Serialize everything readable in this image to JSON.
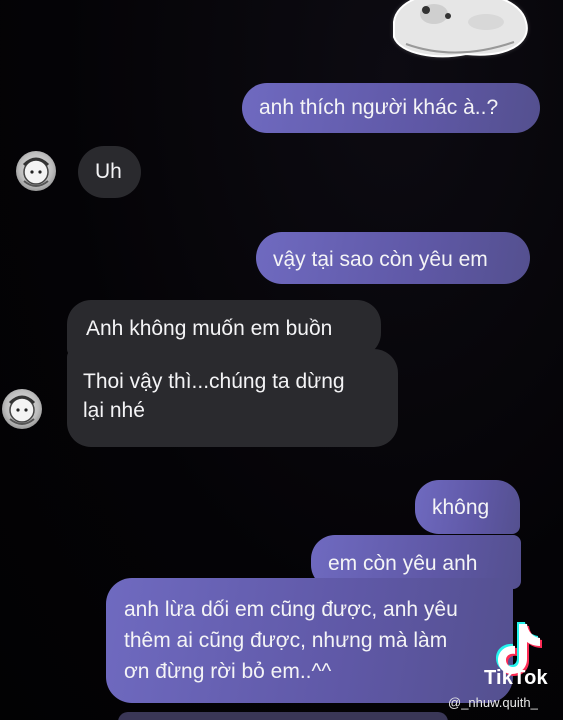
{
  "messages": [
    {
      "side": "sent",
      "text": "anh thích người khác à..?"
    },
    {
      "side": "received",
      "text": "Uh"
    },
    {
      "side": "sent",
      "text": "vậy tại sao còn yêu em"
    },
    {
      "side": "received",
      "text": "Anh không muốn em buồn"
    },
    {
      "side": "received",
      "text": "Thoi vậy thì...chúng ta dừng\nlại nhé"
    },
    {
      "side": "sent",
      "text": "không"
    },
    {
      "side": "sent",
      "text": "em còn yêu anh"
    },
    {
      "side": "sent",
      "text": "anh lừa dối em cũng được, anh yêu\nthêm ai cũng được, nhưng mà làm\nơn đừng rời bỏ em..^^"
    }
  ],
  "watermark": {
    "brand": "TikTok",
    "handle": "@_nhuw.quith_",
    "icon": "tiktok-logo-icon"
  },
  "colors": {
    "sent_bubble": "#6660b0",
    "received_bubble": "#2a2a2e",
    "background": "#050308"
  }
}
